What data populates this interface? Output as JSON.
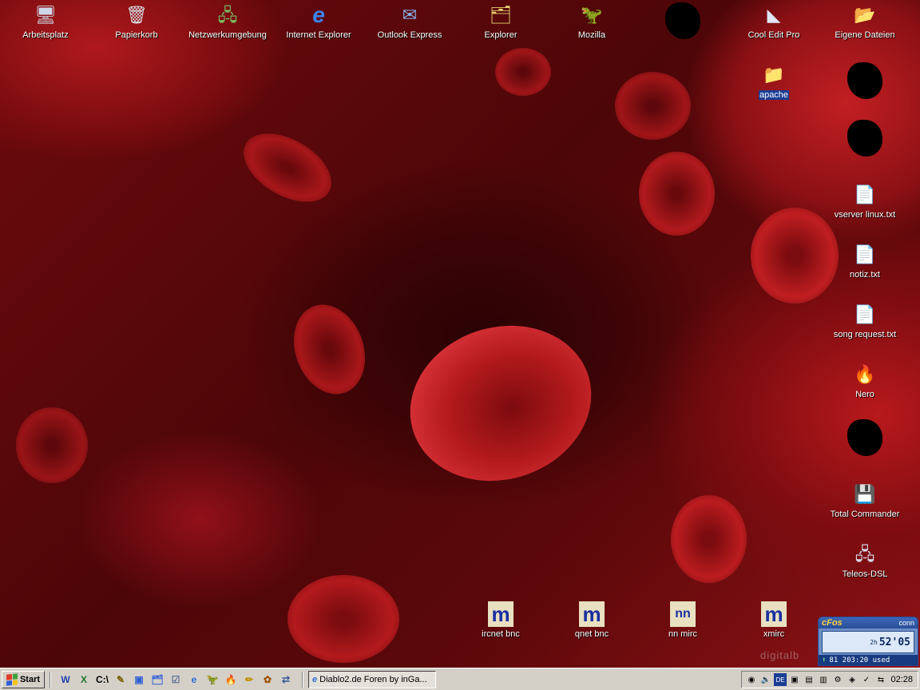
{
  "desktop": {
    "icons": [
      {
        "label": "Arbeitsplatz",
        "glyph": "🖥"
      },
      {
        "label": "Papierkorb",
        "glyph": "🗑"
      },
      {
        "label": "Netzwerkumgebung",
        "glyph": "🖧"
      },
      {
        "label": "Internet Explorer",
        "glyph": "e"
      },
      {
        "label": "Outlook Express",
        "glyph": "✉"
      },
      {
        "label": "Explorer",
        "glyph": "🗂"
      },
      {
        "label": "Mozilla",
        "glyph": "🦖"
      },
      {
        "label": "Cool Edit Pro",
        "glyph": "◣"
      },
      {
        "label": "Eigene Dateien",
        "glyph": "📂"
      },
      {
        "label": "apache",
        "glyph": "📁"
      },
      {
        "label": "vserver linux.txt",
        "glyph": "📄"
      },
      {
        "label": "notiz.txt",
        "glyph": "📄"
      },
      {
        "label": "song request.txt",
        "glyph": "📄"
      },
      {
        "label": "Nero",
        "glyph": "🔥"
      },
      {
        "label": "Total Commander",
        "glyph": "💾"
      },
      {
        "label": "Teleos-DSL",
        "glyph": "🖧"
      },
      {
        "label": "ircnet bnc",
        "glyph": "m"
      },
      {
        "label": "qnet bnc",
        "glyph": "m"
      },
      {
        "label": "nn mirc",
        "glyph": "nn"
      },
      {
        "label": "xmirc",
        "glyph": "m"
      }
    ],
    "watermark": "digitalb"
  },
  "taskbar": {
    "start_label": "Start",
    "quick_launch": [
      {
        "glyph": "W",
        "color": "#1f3fb0"
      },
      {
        "glyph": "X",
        "color": "#1d7a2e"
      },
      {
        "glyph": "C:\\",
        "color": "#000000"
      },
      {
        "glyph": "✎",
        "color": "#7a5a00"
      },
      {
        "glyph": "▣",
        "color": "#2f5fd6"
      },
      {
        "glyph": "🗂",
        "color": "#2f5fd6"
      },
      {
        "glyph": "☑",
        "color": "#5a6f9a"
      },
      {
        "glyph": "e",
        "color": "#2a6fd6"
      },
      {
        "glyph": "🦖",
        "color": "#a01010"
      },
      {
        "glyph": "🔥",
        "color": "#d03010"
      },
      {
        "glyph": "✏",
        "color": "#c09000"
      },
      {
        "glyph": "✿",
        "color": "#a05000"
      },
      {
        "glyph": "⇄",
        "color": "#3a5a9a"
      }
    ],
    "task_button": {
      "label": "Diablo2.de Foren by inGa...",
      "glyph": "e"
    },
    "tray": {
      "icons": [
        {
          "glyph": "◉"
        },
        {
          "glyph": "🔈"
        },
        {
          "glyph": "DE"
        },
        {
          "glyph": "▣"
        },
        {
          "glyph": "▤"
        },
        {
          "glyph": "▥"
        },
        {
          "glyph": "⚙"
        },
        {
          "glyph": "◈"
        },
        {
          "glyph": "✓"
        },
        {
          "glyph": "⇆"
        }
      ],
      "clock": "02:28"
    }
  },
  "cfos": {
    "brand": "cFos",
    "status": "conn",
    "time_small": "2h",
    "time_big": "52'05",
    "footer": "81  203:20 used"
  }
}
